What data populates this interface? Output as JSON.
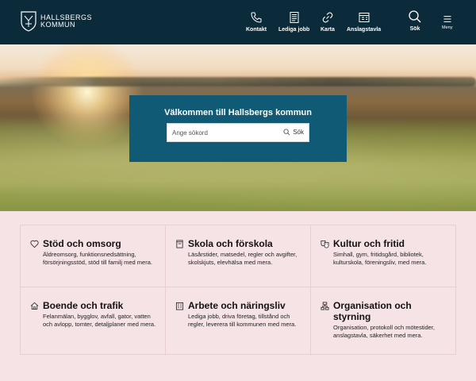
{
  "header": {
    "logo_line1": "HALLSBERGS",
    "logo_line2": "KOMMUN",
    "nav": [
      {
        "label": "Kontakt",
        "icon": "phone-icon"
      },
      {
        "label": "Lediga jobb",
        "icon": "job-board-icon"
      },
      {
        "label": "Karta",
        "icon": "link-icon"
      },
      {
        "label": "Anslagstavla",
        "icon": "notice-board-icon"
      },
      {
        "label": "Sök",
        "icon": "search-icon"
      },
      {
        "label": "Meny",
        "icon": "hamburger-icon"
      }
    ]
  },
  "hero": {
    "title": "Välkommen till Hallsbergs kommun",
    "search_placeholder": "Ange sökord",
    "search_button": "Sök"
  },
  "categories": [
    {
      "title": "Stöd och omsorg",
      "icon": "heart-icon",
      "desc": "Äldreomsorg, funktionsnedsättning, försörjningsstöd, stöd till familj med mera."
    },
    {
      "title": "Skola och förskola",
      "icon": "book-icon",
      "desc": "Läsårstider, matsedel, regler och avgifter, skolskjuts, elevhälsa med mera."
    },
    {
      "title": "Kultur och fritid",
      "icon": "masks-icon",
      "desc": "Simhall, gym, fritidsgård, bibliotek, kulturskola, föreningsliv, med mera."
    },
    {
      "title": "Boende och trafik",
      "icon": "house-icon",
      "desc": "Felanmälan, bygglov, avfall, gator, vatten och avlopp, tomter, detaljplaner med mera."
    },
    {
      "title": "Arbete och näringsliv",
      "icon": "building-icon",
      "desc": "Lediga jobb, driva företag, tillstånd och regler, leverera till kommunen med mera."
    },
    {
      "title": "Organisation och styrning",
      "icon": "org-chart-icon",
      "desc": "Organisation, protokoll och mötestider, anslagstavla, säkerhet med mera."
    }
  ],
  "colors": {
    "header_bg": "#0b2a3a",
    "search_panel_bg": "#115a75",
    "grid_bg": "#f6e3e6"
  }
}
